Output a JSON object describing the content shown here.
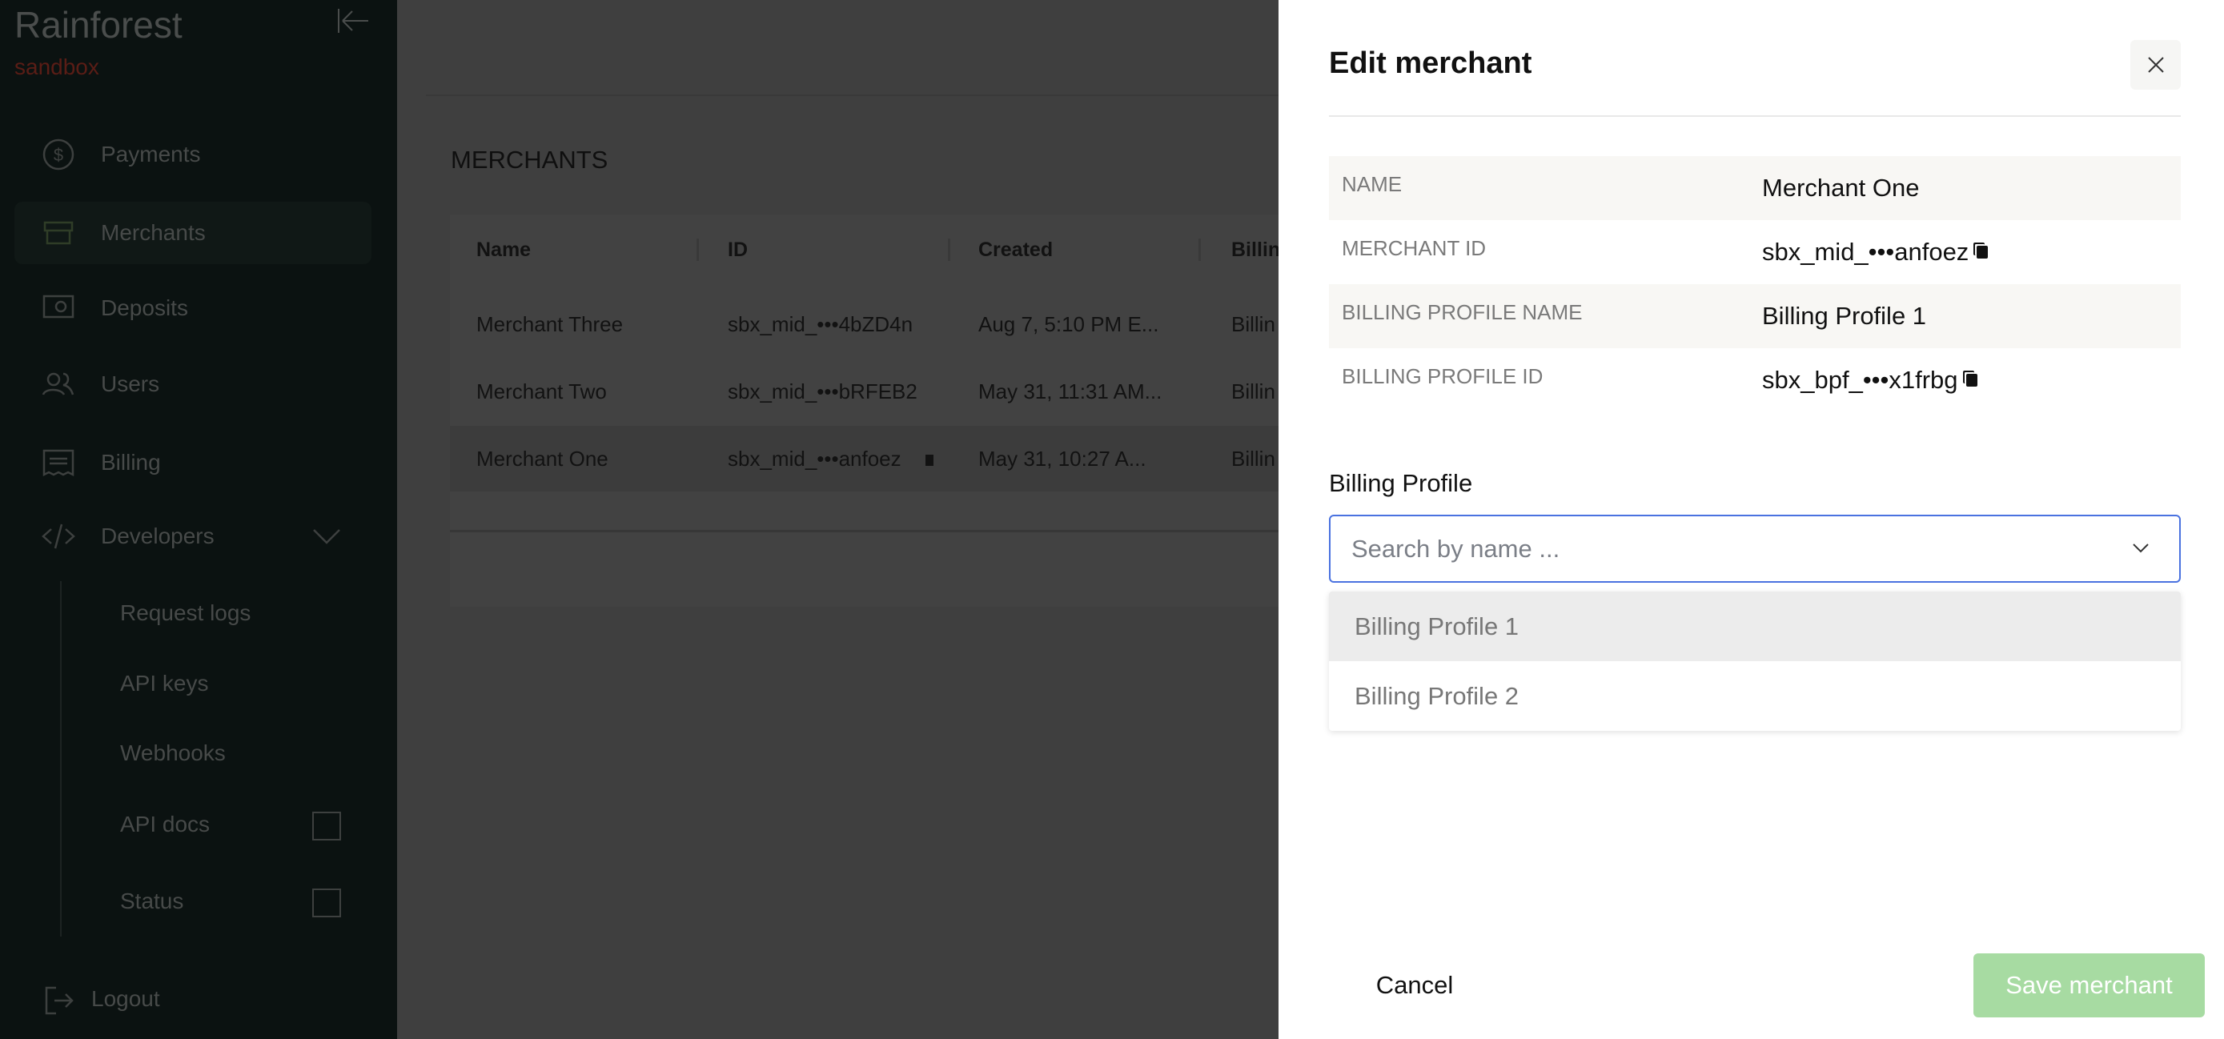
{
  "sidebar": {
    "logo": "Rainforest",
    "env": "sandbox",
    "items": [
      {
        "label": "Payments",
        "icon": "dollar-circle-icon"
      },
      {
        "label": "Merchants",
        "icon": "storefront-icon",
        "active": true
      },
      {
        "label": "Deposits",
        "icon": "safe-icon"
      },
      {
        "label": "Users",
        "icon": "users-icon"
      },
      {
        "label": "Billing",
        "icon": "receipt-icon"
      },
      {
        "label": "Developers",
        "icon": "code-icon"
      }
    ],
    "sub_items": [
      {
        "label": "Request logs"
      },
      {
        "label": "API keys"
      },
      {
        "label": "Webhooks"
      },
      {
        "label": "API docs",
        "external": true
      },
      {
        "label": "Status",
        "external": true
      }
    ],
    "logout": "Logout"
  },
  "main": {
    "heading": "MERCHANTS",
    "columns": [
      "Name",
      "ID",
      "Created",
      "Billin"
    ],
    "rows": [
      {
        "name": "Merchant Three",
        "id": "sbx_mid_•••4bZD4n",
        "created": "Aug 7, 5:10 PM E...",
        "billing": "Billin"
      },
      {
        "name": "Merchant Two",
        "id": "sbx_mid_•••bRFEB2",
        "created": "May 31, 11:31 AM...",
        "billing": "Billin"
      },
      {
        "name": "Merchant One",
        "id": "sbx_mid_•••anfoez",
        "created": "May 31, 10:27 A...",
        "billing": "Billin"
      }
    ]
  },
  "panel": {
    "title": "Edit merchant",
    "details": [
      {
        "label": "NAME",
        "value": "Merchant One"
      },
      {
        "label": "MERCHANT ID",
        "value": "sbx_mid_•••anfoez",
        "copy": true
      },
      {
        "label": "BILLING PROFILE NAME",
        "value": "Billing Profile 1"
      },
      {
        "label": "BILLING PROFILE ID",
        "value": "sbx_bpf_•••x1frbg",
        "copy": true
      }
    ],
    "field_label": "Billing Profile",
    "placeholder": "Search by name ...",
    "options": [
      "Billing Profile 1",
      "Billing Profile 2"
    ],
    "cancel": "Cancel",
    "save": "Save merchant"
  },
  "colors": {
    "save_disabled": "#a7dba2",
    "focus_border": "#4a72e0",
    "env": "#5a1d16"
  }
}
